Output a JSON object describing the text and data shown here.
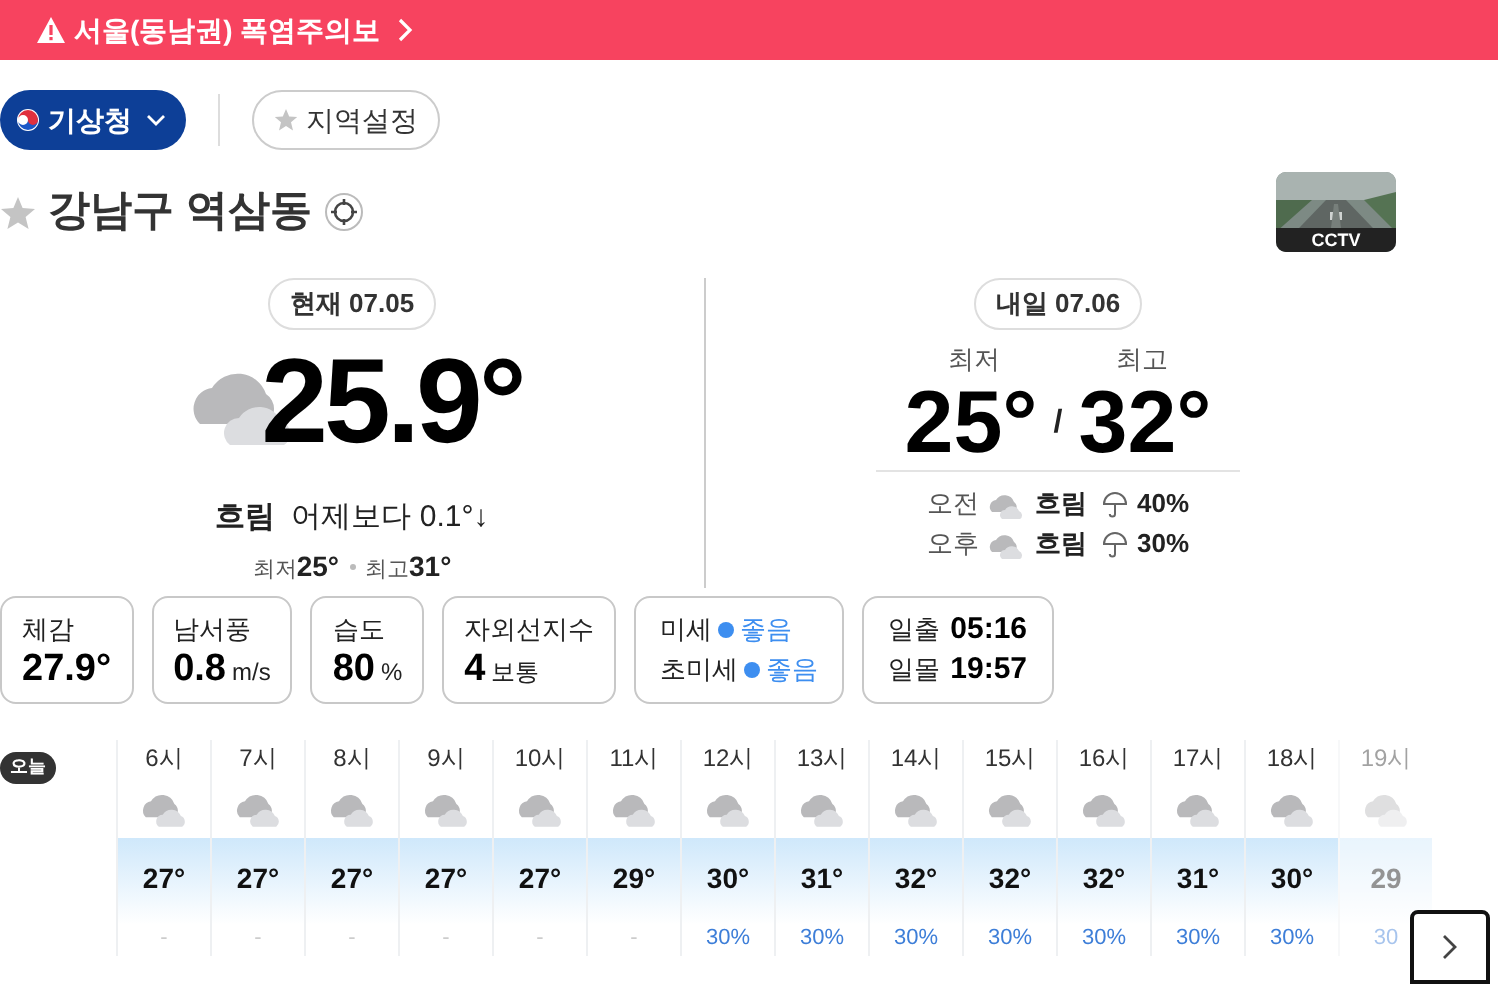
{
  "alert": {
    "text": "서울(동남권) 폭염주의보"
  },
  "source_button": {
    "label": "기상청"
  },
  "region_button": {
    "label": "지역설정"
  },
  "location": {
    "name": "강남구 역삼동",
    "favorite": false
  },
  "cctv": {
    "label": "CCTV"
  },
  "current": {
    "date_label": "현재 07.05",
    "temperature": "25.9°",
    "condition": "흐림",
    "comparison": "어제보다 0.1°↓",
    "low_label": "최저",
    "low": "25°",
    "high_label": "최고",
    "high": "31°"
  },
  "tomorrow": {
    "date_label": "내일 07.06",
    "low_label": "최저",
    "high_label": "최고",
    "low": "25°",
    "separator": "/",
    "high": "32°",
    "periods": [
      {
        "label": "오전",
        "condition": "흐림",
        "rain": "40%"
      },
      {
        "label": "오후",
        "condition": "흐림",
        "rain": "30%"
      }
    ]
  },
  "stats": [
    {
      "kind": "value",
      "label": "체감",
      "value": "27.9°"
    },
    {
      "kind": "value",
      "label": "남서풍",
      "value": "0.8",
      "unit": "m/s"
    },
    {
      "kind": "value",
      "label": "습도",
      "value": "80",
      "unit": "%"
    },
    {
      "kind": "value",
      "label": "자외선지수",
      "value": "4",
      "unit": "보통"
    },
    {
      "kind": "air",
      "rows": [
        {
          "label": "미세",
          "value": "좋음",
          "color": "#3d8ef0"
        },
        {
          "label": "초미세",
          "value": "좋음",
          "color": "#3d8ef0"
        }
      ]
    },
    {
      "kind": "sun",
      "rows": [
        {
          "label": "일출",
          "value": "05:16"
        },
        {
          "label": "일몰",
          "value": "19:57"
        }
      ]
    }
  ],
  "hourly": {
    "day_badge": "오늘",
    "hours": [
      {
        "time": "6시",
        "temp": "27°",
        "rain": "-",
        "faded": false
      },
      {
        "time": "7시",
        "temp": "27°",
        "rain": "-",
        "faded": false
      },
      {
        "time": "8시",
        "temp": "27°",
        "rain": "-",
        "faded": false
      },
      {
        "time": "9시",
        "temp": "27°",
        "rain": "-",
        "faded": false
      },
      {
        "time": "10시",
        "temp": "27°",
        "rain": "-",
        "faded": false
      },
      {
        "time": "11시",
        "temp": "29°",
        "rain": "-",
        "faded": false
      },
      {
        "time": "12시",
        "temp": "30°",
        "rain": "30%",
        "faded": false
      },
      {
        "time": "13시",
        "temp": "31°",
        "rain": "30%",
        "faded": false
      },
      {
        "time": "14시",
        "temp": "32°",
        "rain": "30%",
        "faded": false
      },
      {
        "time": "15시",
        "temp": "32°",
        "rain": "30%",
        "faded": false
      },
      {
        "time": "16시",
        "temp": "32°",
        "rain": "30%",
        "faded": false
      },
      {
        "time": "17시",
        "temp": "31°",
        "rain": "30%",
        "faded": false
      },
      {
        "time": "18시",
        "temp": "30°",
        "rain": "30%",
        "faded": false
      },
      {
        "time": "19시",
        "temp": "29",
        "rain": "30",
        "faded": true
      }
    ]
  }
}
